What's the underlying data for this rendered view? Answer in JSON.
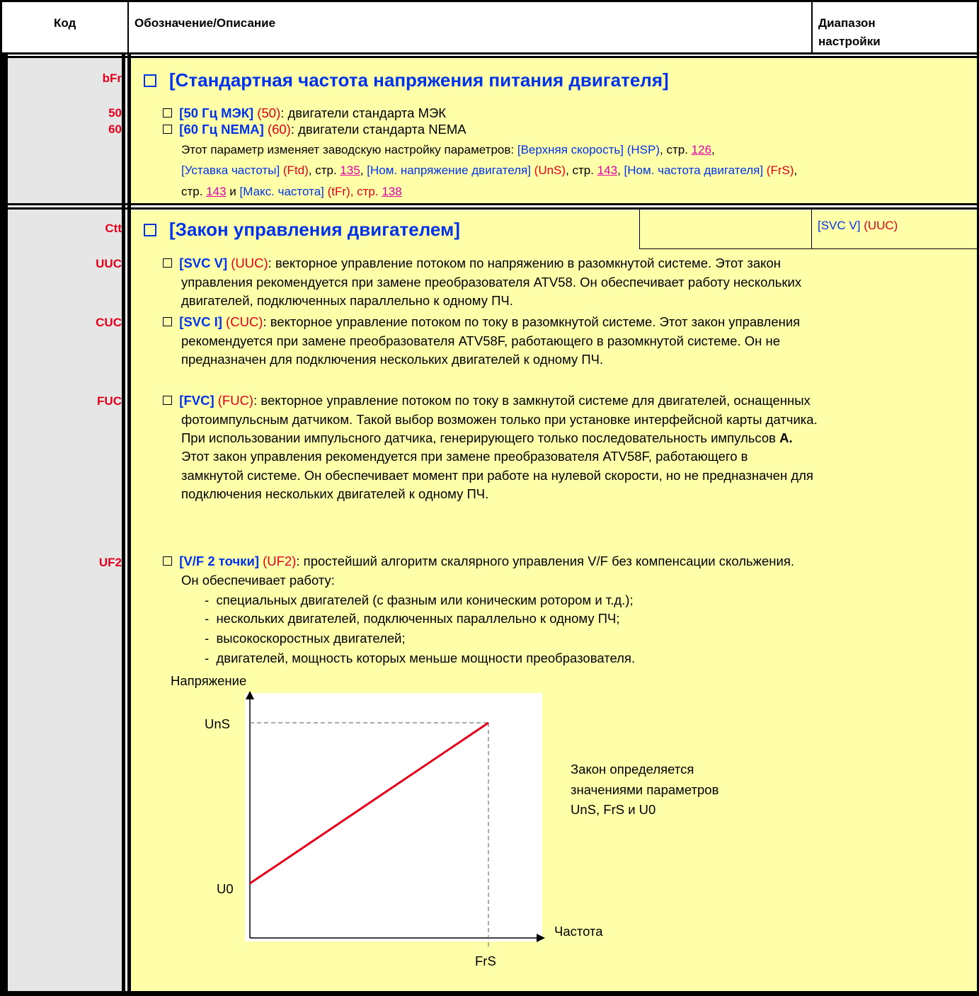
{
  "header": {
    "col_code": "Код",
    "col_desc": "Обозначение/Описание",
    "col_range_1": "Диапазон",
    "col_range_2": "настройки"
  },
  "bfr": {
    "code": "bFr",
    "title": "[Стандартная частота напряжения питания двигателя]",
    "opt1_code": "50",
    "opt1_label": "[50 Гц МЭК]",
    "opt1_param": "(50)",
    "opt1_text": ": двигатели стандарта МЭК",
    "opt2_code": "60",
    "opt2_label": "[60 Гц NEMA]",
    "opt2_param": "(60)",
    "opt2_text": ": двигатели стандарта NEMA",
    "note": {
      "l1a": "Этот параметр изменяет заводскую настройку параметров: ",
      "l1b": "[Верхняя скорость] (HSP)",
      "l1c": ", стр. ",
      "l1d": "126",
      "l1e": ",",
      "l2a": "[Уставка частоты]",
      "l2b": " (Ftd)",
      "l2c": ", стр. ",
      "l2d": "135",
      "l2e": ", ",
      "l2f": "[Ном. напряжение двигателя]",
      "l2g": " (UnS)",
      "l2h": ", стр. ",
      "l2i": "143",
      "l2j": ", ",
      "l2k": "[Ном. частота двигателя]",
      "l2l": " (FrS)",
      "l2m": ",",
      "l3a": "стр. ",
      "l3b": "143",
      "l3c": " и ",
      "l3d": "[Макс. частота]",
      "l3e": " (tFr), стр. ",
      "l3f": "138"
    }
  },
  "ctt": {
    "code": "Ctt",
    "title": "[Закон управления двигателем]",
    "default_label": "[SVC V]",
    "default_param": " (UUC)",
    "uuc": {
      "code": "UUC",
      "label": "[SVC V]",
      "param": " (UUC)",
      "l1": ": векторное управление потоком по напряжению в разомкнутой системе. Этот закон",
      "l2": "управления рекомендуется при замене преобразователя  ATV58. Он обеспечивает работу нескольких",
      "l3": "двигателей, подключенных параллельно к одному ПЧ."
    },
    "cuc": {
      "code": "CUC",
      "label": "[SVC I]",
      "param": " (CUC)",
      "l1": ": векторное управление потоком по току в разомкнутой системе. Этот закон управления",
      "l2": "рекомендуется при замене преобразователя  ATV58F, работающего в разомкнутой системе. Он не",
      "l3": "предназначен для подключения нескольких двигателей к одному ПЧ."
    },
    "fuc": {
      "code": "FUC",
      "label": "[FVC]",
      "param": " (FUC)",
      "l1": ": векторное управление потоком по току в замкнутой системе для двигателей, оснащенных",
      "l2": "фотоимпульсным датчиком. Такой выбор возможен только при установке интерфейсной карты датчика.",
      "l3a": "При использовании импульсного датчика, генерирующего только последовательность импульсов ",
      "l3b": "A.",
      "l4": "Этот закон управления рекомендуется при замене преобразователя  ATV58F, работающего в",
      "l5": "замкнутой системе. Он обеспечивает момент при работе на нулевой скорости, но не предназначен для",
      "l6": "подключения нескольких двигателей к одному ПЧ."
    },
    "uf2": {
      "code": "UF2",
      "label": "[V/F 2 точки]",
      "param": " (UF2)",
      "l1": ": простейший алгоритм скалярного управления V/F без компенсации скольжения.",
      "l2": "Он обеспечивает работу:",
      "items": [
        "специальных двигателей (с фазным или коническим ротором и т.д.);",
        "нескольких двигателей, подключенных параллельно к одному ПЧ;",
        "высокоскоростных двигателей;",
        "двигателей, мощность которых меньше мощности преобразователя."
      ]
    }
  },
  "chart_data": {
    "type": "line",
    "ylabel": "Напряжение",
    "xlabel": "Частота",
    "x_ticks": [
      "FrS"
    ],
    "y_ticks": [
      "U0",
      "UnS"
    ],
    "series": [
      {
        "points": [
          [
            "0",
            "U0"
          ],
          [
            "FrS",
            "UnS"
          ]
        ]
      }
    ],
    "line_color": "#e2001a",
    "annotation": [
      "Закон определяется",
      "значениями параметров",
      "UnS, FrS и U0"
    ]
  }
}
